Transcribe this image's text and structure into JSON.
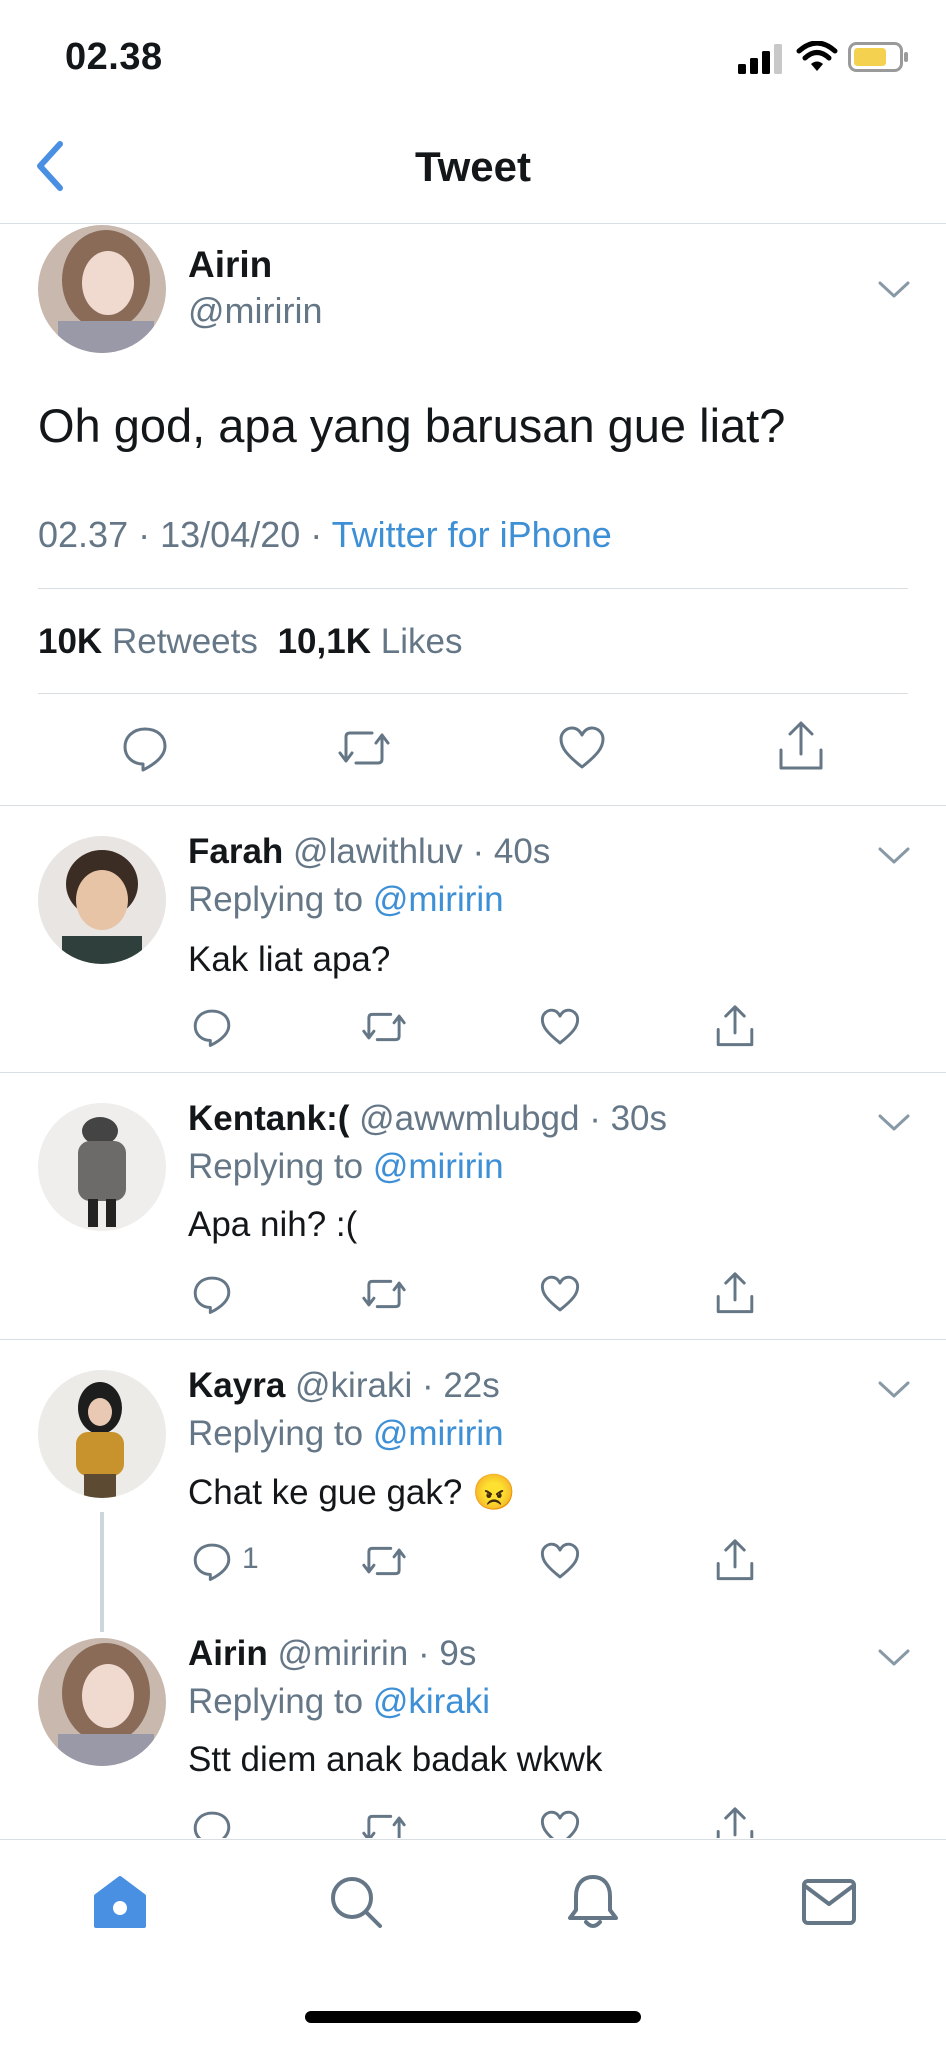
{
  "status_bar": {
    "time": "02.38",
    "signal_icon": "signal-bars-icon",
    "wifi_icon": "wifi-icon",
    "battery_icon": "battery-icon",
    "battery_color": "#f4d24f"
  },
  "header": {
    "title": "Tweet",
    "back_icon": "chevron-left-icon"
  },
  "tweet": {
    "name": "Airin",
    "handle": "@miririn",
    "text": "Oh god, apa yang barusan gue liat?",
    "time": "02.37",
    "date": "13/04/20",
    "source": "Twitter for iPhone",
    "retweets_count": "10K",
    "retweets_label": "Retweets",
    "likes_count": "10,1K",
    "likes_label": "Likes"
  },
  "replies": [
    {
      "name": "Farah",
      "handle": "@lawithluv",
      "age": "40s",
      "replying_label": "Replying to",
      "replying_to": "@miririn",
      "text": "Kak liat apa?",
      "reply_count": ""
    },
    {
      "name": "Kentank:(",
      "handle": "@awwmlubgd",
      "age": "30s",
      "replying_label": "Replying to",
      "replying_to": "@miririn",
      "text": "Apa nih? :(",
      "reply_count": ""
    },
    {
      "name": "Kayra",
      "handle": "@kiraki",
      "age": "22s",
      "replying_label": "Replying to",
      "replying_to": "@miririn",
      "text": "Chat ke gue gak? 😠",
      "reply_count": "1"
    },
    {
      "name": "Airin",
      "handle": "@miririn",
      "age": "9s",
      "replying_label": "Replying to",
      "replying_to": "@kiraki",
      "text": "Stt diem anak badak wkwk",
      "reply_count": ""
    }
  ],
  "tab_bar": {
    "items": [
      "home-icon",
      "search-icon",
      "bell-icon",
      "mail-icon"
    ],
    "active": "home-icon",
    "accent": "#4a90e2"
  },
  "colors": {
    "link": "#3d8fd6",
    "muted": "#657786",
    "divider": "#d9dee2"
  }
}
